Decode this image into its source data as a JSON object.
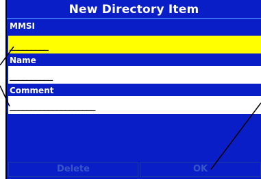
{
  "dialog": {
    "title": "New Directory Item"
  },
  "fields": [
    {
      "label": "MMSI",
      "value": "_________",
      "selected": true
    },
    {
      "label": "Name",
      "value": "__________",
      "selected": false
    },
    {
      "label": "Comment",
      "value": "____________________",
      "selected": false
    }
  ],
  "buttons": {
    "delete_label": "Delete",
    "ok_label": "OK"
  },
  "colors": {
    "background": "#0a1ec8",
    "selected_field": "#ffff00",
    "field": "#ffffff",
    "text": "#ffffff",
    "disabled_button_text": "#3a55c8"
  }
}
